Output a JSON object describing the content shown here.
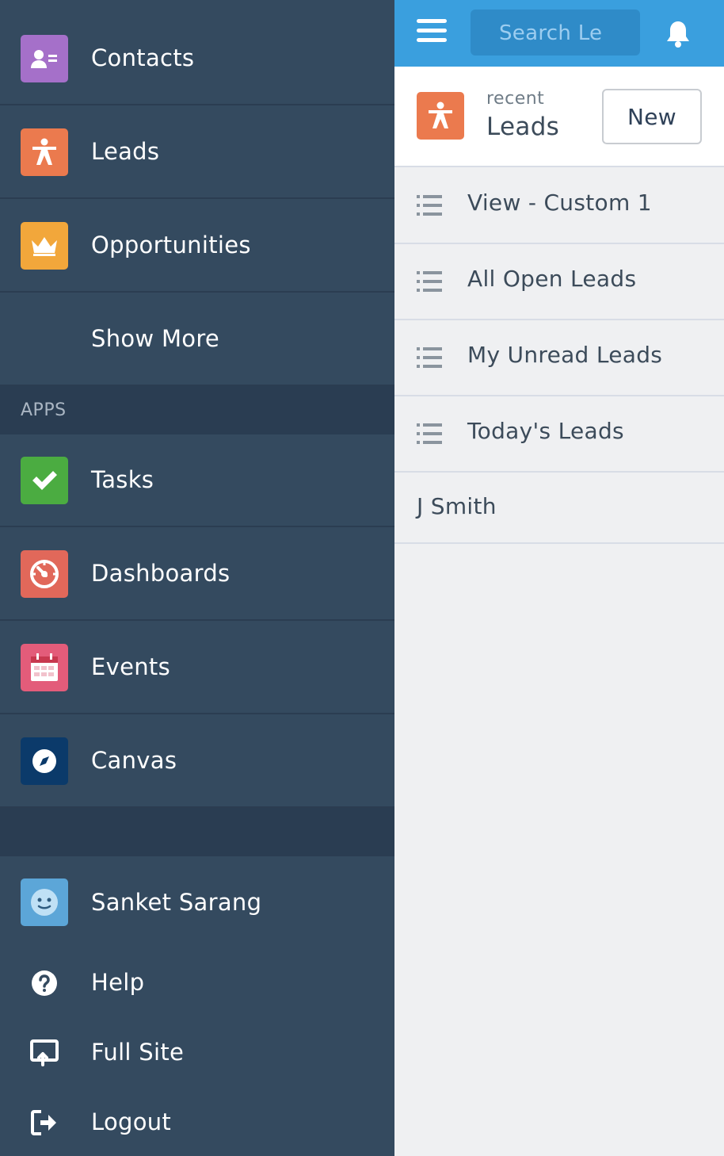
{
  "sidebar": {
    "items": [
      {
        "label": "Contacts",
        "icon": "contact-card-icon",
        "color": "#a570c9"
      },
      {
        "label": "Leads",
        "icon": "lead-person-icon",
        "color": "#eb7a4e"
      },
      {
        "label": "Opportunities",
        "icon": "crown-icon",
        "color": "#f2a73b"
      },
      {
        "label": "Show More"
      }
    ],
    "apps_heading": "APPS",
    "apps": [
      {
        "label": "Tasks",
        "icon": "checkmark-icon",
        "color": "#4bac41"
      },
      {
        "label": "Dashboards",
        "icon": "gauge-icon",
        "color": "#e1685a"
      },
      {
        "label": "Events",
        "icon": "calendar-icon",
        "color": "#e35c7a"
      },
      {
        "label": "Canvas",
        "icon": "compass-icon",
        "color": "#0b3a6a"
      }
    ],
    "user": {
      "label": "Sanket Sarang",
      "icon": "avatar-face-icon"
    },
    "links": [
      {
        "label": "Help",
        "icon": "help-question-icon"
      },
      {
        "label": "Full Site",
        "icon": "full-site-icon"
      },
      {
        "label": "Logout",
        "icon": "logout-icon"
      }
    ]
  },
  "topbar": {
    "search_placeholder": "Search Leads",
    "accent": "#3a9fde"
  },
  "header": {
    "subtitle": "recent",
    "title": "Leads",
    "new_label": "New"
  },
  "list_views": [
    {
      "label": "View - Custom 1"
    },
    {
      "label": "All Open Leads"
    },
    {
      "label": "My Unread Leads"
    },
    {
      "label": "Today's Leads"
    }
  ],
  "records": [
    {
      "label": "J Smith"
    }
  ]
}
